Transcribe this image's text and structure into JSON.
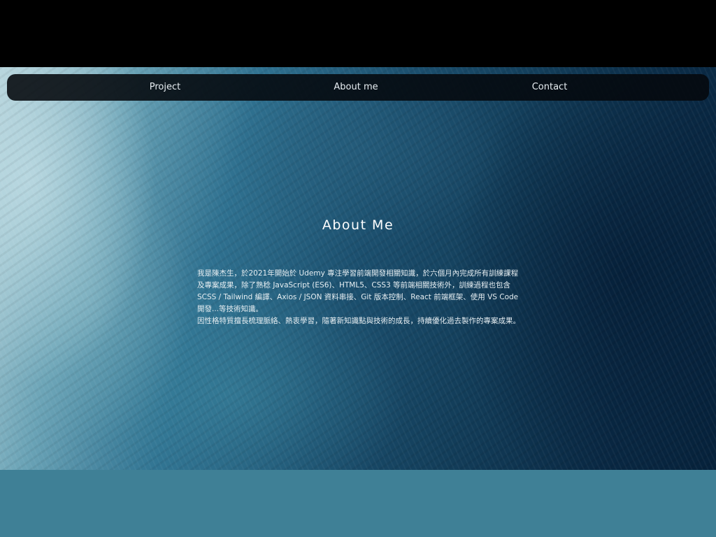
{
  "nav": {
    "items": [
      {
        "label": "Project"
      },
      {
        "label": "About me"
      },
      {
        "label": "Contact"
      }
    ]
  },
  "about": {
    "title": "About Me",
    "paragraph_1": "我是陳杰生，於2021年開始於 Udemy 專注學習前端開發相關知識，於六個月內完成所有訓練課程及專案成果，除了熟稔 JavaScript (ES6)、HTML5、CSS3 等前端相關技術外，訓練過程也包含 SCSS / Tailwind 編譯、Axios / JSON 資料串接、Git 版本控制、React 前端框架、使用 VS Code 開發...等技術知識。",
    "paragraph_2": "因性格特質擅長梳理脈絡、熱衷學習，隨著新知識點與技術的成長，持續優化過去製作的專案成果。"
  },
  "colors": {
    "navbar_bg": "#05080c",
    "bottom_band": "#3f8096",
    "text": "#ffffff"
  }
}
